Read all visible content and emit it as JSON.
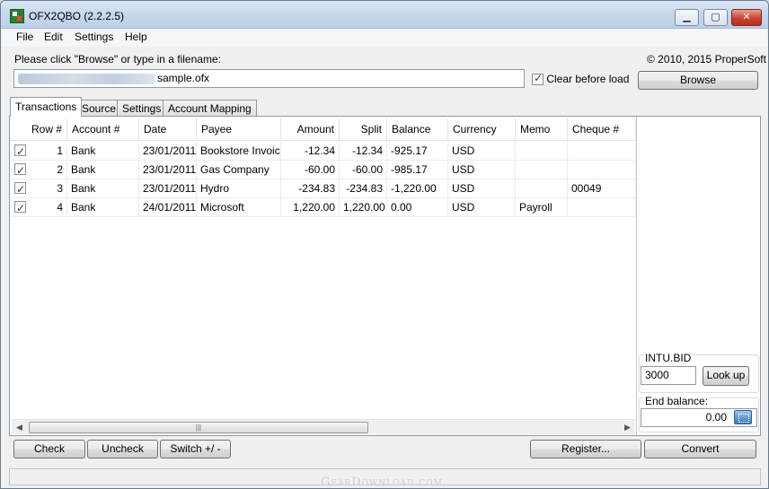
{
  "window": {
    "title": "OFX2QBO (2.2.2.5)"
  },
  "menu": [
    "File",
    "Edit",
    "Settings",
    "Help"
  ],
  "prompt": "Please click \"Browse\" or type in a filename:",
  "copyright": "© 2010, 2015 ProperSoft",
  "file": {
    "value": "sample.ofx"
  },
  "clear_before_load": {
    "label": "Clear before load",
    "checked": true
  },
  "browse_label": "Browse",
  "tabs": [
    "Transactions",
    "Source",
    "Settings",
    "Account Mapping"
  ],
  "active_tab": "Transactions",
  "table": {
    "columns": [
      "Row #",
      "Account #",
      "Date",
      "Payee",
      "Amount",
      "Split",
      "Balance",
      "Currency",
      "Memo",
      "Cheque #"
    ],
    "rows": [
      {
        "checked": true,
        "row": "1",
        "account": "Bank",
        "date": "23/01/2011",
        "payee": "Bookstore Invoice",
        "amount": "-12.34",
        "split": "-12.34",
        "balance": "-925.17",
        "currency": "USD",
        "memo": "",
        "cheque": ""
      },
      {
        "checked": true,
        "row": "2",
        "account": "Bank",
        "date": "23/01/2011",
        "payee": "Gas Company",
        "amount": "-60.00",
        "split": "-60.00",
        "balance": "-985.17",
        "currency": "USD",
        "memo": "",
        "cheque": ""
      },
      {
        "checked": true,
        "row": "3",
        "account": "Bank",
        "date": "23/01/2011",
        "payee": "Hydro",
        "amount": "-234.83",
        "split": "-234.83",
        "balance": "-1,220.00",
        "currency": "USD",
        "memo": "",
        "cheque": "00049"
      },
      {
        "checked": true,
        "row": "4",
        "account": "Bank",
        "date": "24/01/2011",
        "payee": "Microsoft",
        "amount": "1,220.00",
        "split": "1,220.00",
        "balance": "0.00",
        "currency": "USD",
        "memo": "Payroll",
        "cheque": ""
      }
    ]
  },
  "intu": {
    "label": "INTU.BID",
    "value": "3000",
    "lookup_label": "Look up"
  },
  "end_balance": {
    "label": "End balance:",
    "value": "0.00"
  },
  "buttons": {
    "check": "Check",
    "uncheck": "Uncheck",
    "switch": "Switch +/ -",
    "register": "Register...",
    "convert": "Convert"
  },
  "watermark": "GearDownload.com",
  "icons": {
    "app": "app-icon",
    "calc": "calculator-icon",
    "checkbox": "checkmark"
  }
}
